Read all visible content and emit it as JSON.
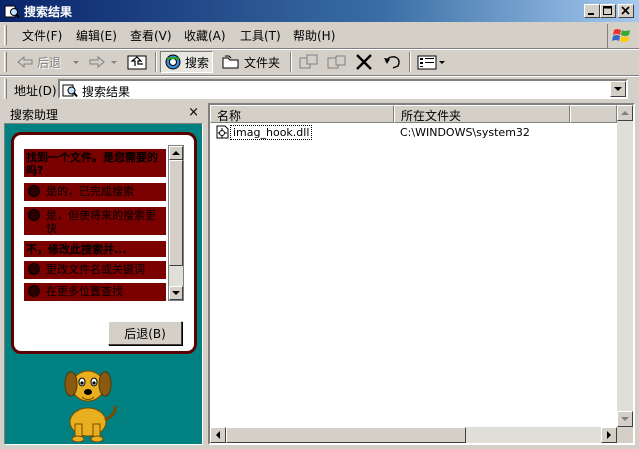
{
  "window": {
    "title": "搜索结果",
    "controls": {
      "minimize": "minimize",
      "maximize": "maximize",
      "close": "close"
    }
  },
  "menubar": {
    "items": [
      {
        "label": "文件(F)"
      },
      {
        "label": "编辑(E)"
      },
      {
        "label": "查看(V)"
      },
      {
        "label": "收藏(A)"
      },
      {
        "label": "工具(T)"
      },
      {
        "label": "帮助(H)"
      }
    ]
  },
  "toolbar": {
    "back_label": "后退",
    "search_label": "搜索",
    "folders_label": "文件夹"
  },
  "address": {
    "label": "地址(D)",
    "value": "搜索结果"
  },
  "assistant": {
    "title": "搜索助理",
    "close": "×",
    "items": [
      {
        "kind": "head",
        "text": "找到一个文件。是您需要的吗?"
      },
      {
        "kind": "opt",
        "text": "是的，已完成搜索"
      },
      {
        "kind": "opt",
        "text": "是，但使将来的搜索更快"
      },
      {
        "kind": "head",
        "text": "不，修改此搜索并..."
      },
      {
        "kind": "opt",
        "text": "更改文件名或关键词"
      },
      {
        "kind": "opt",
        "text": "在更多位置查找"
      }
    ],
    "back_button": "后退(B)"
  },
  "results": {
    "columns": [
      {
        "label": "名称"
      },
      {
        "label": "所在文件夹"
      }
    ],
    "rows": [
      {
        "name": "imag_hook.dll",
        "folder": "C:\\WINDOWS\\system32"
      }
    ]
  },
  "colors": {
    "titlebar_start": "#0a246a",
    "titlebar_end": "#a6caf0",
    "face": "#d4d0c8",
    "assistant_bg": "#008080",
    "bubble_border": "#5a0000",
    "bubble_item": "#7b0000",
    "dog": "#e8b020"
  }
}
